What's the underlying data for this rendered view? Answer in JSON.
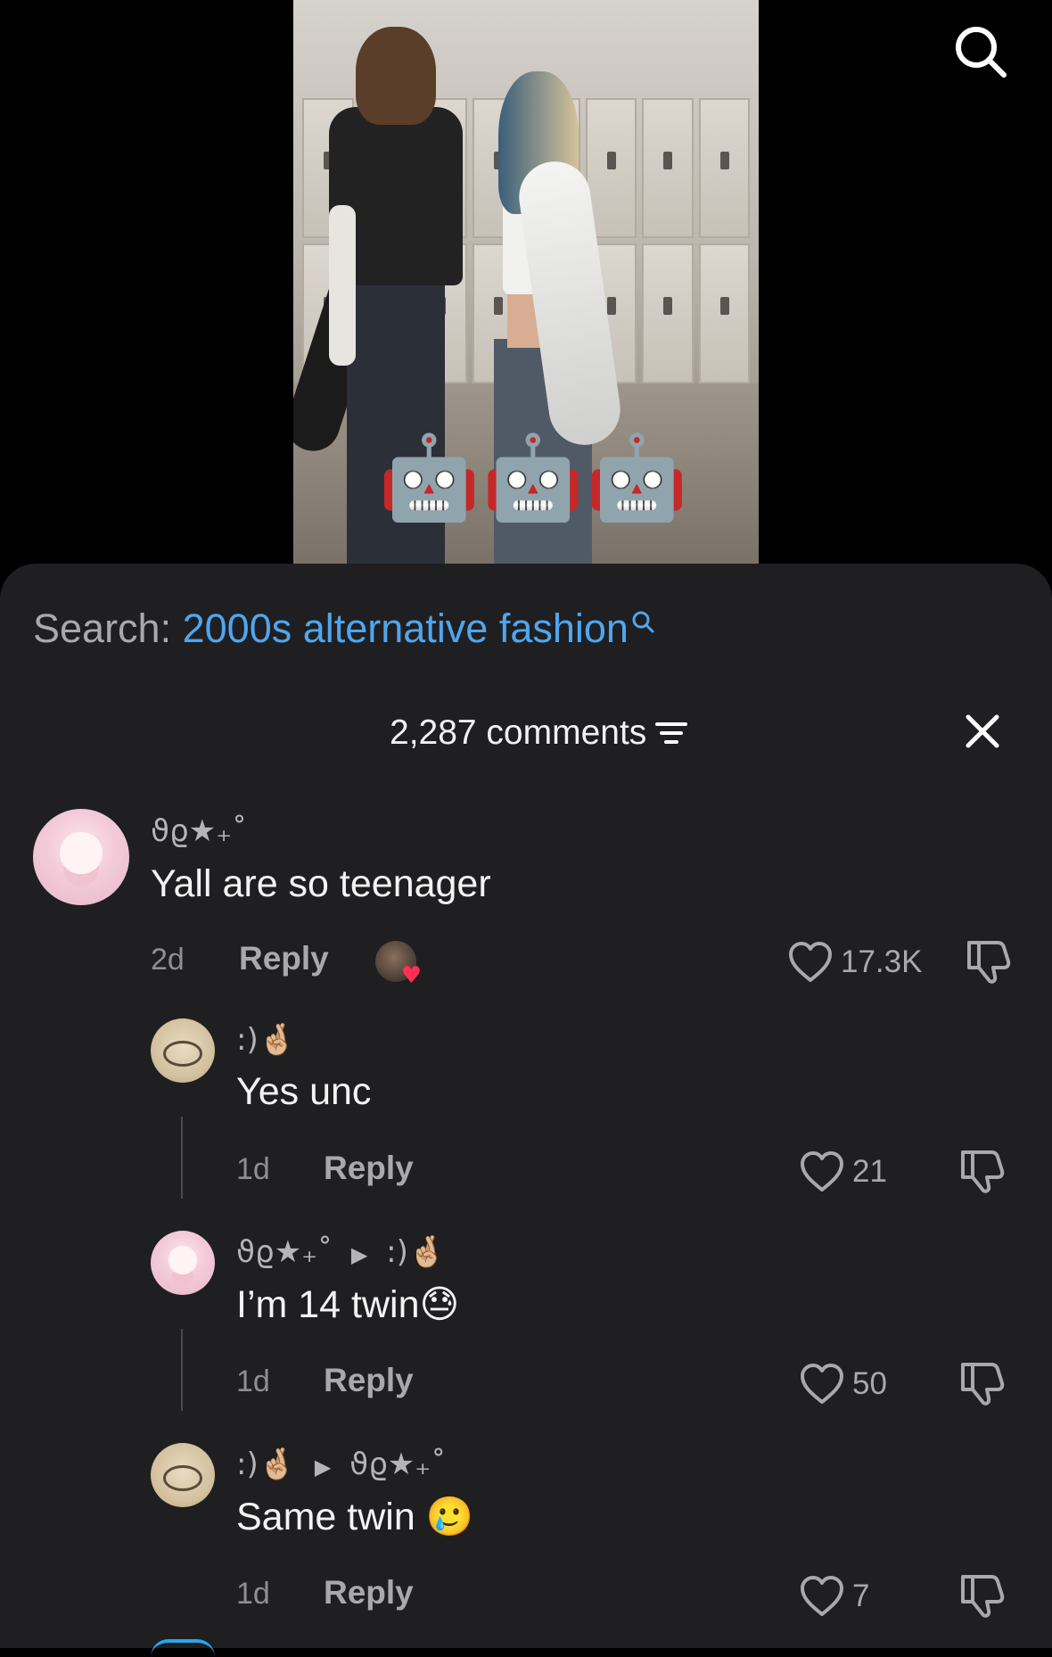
{
  "video": {
    "overlay_emojis": "🤖🤖🤖"
  },
  "search_bar": {
    "prefix": "Search:",
    "term": "2000s alternative fashion"
  },
  "comments_header": {
    "count_label": "2,287 comments"
  },
  "comments": [
    {
      "username": "ϑϱ★₊˚",
      "text": "Yall are so teenager",
      "age": "2d",
      "reply_label": "Reply",
      "likes": "17.3K"
    },
    {
      "username": ":)🤞🏼",
      "text": "Yes unc",
      "age": "1d",
      "reply_label": "Reply",
      "likes": "21"
    },
    {
      "username": "ϑϱ★₊˚",
      "reply_to": ":)🤞🏼",
      "text": "I’m 14 twin",
      "text_emoji": "😓",
      "age": "1d",
      "reply_label": "Reply",
      "likes": "50"
    },
    {
      "username": ":)🤞🏼",
      "reply_to": "ϑϱ★₊˚",
      "text": "Same twin",
      "text_emoji": "🥲",
      "age": "1d",
      "reply_label": "Reply",
      "likes": "7"
    }
  ]
}
